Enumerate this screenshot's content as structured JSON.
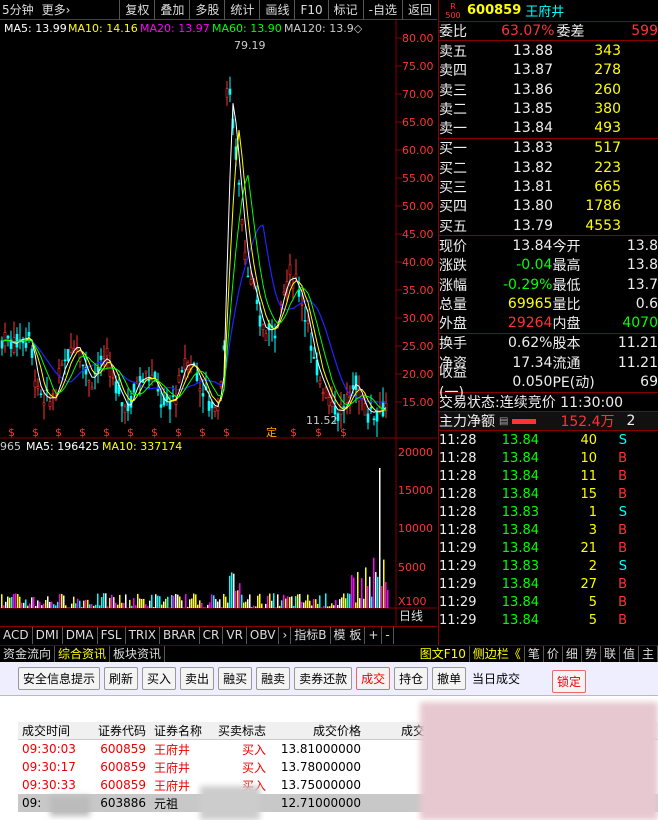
{
  "topbar": {
    "interval": "5分钟",
    "more": "更多›",
    "buttons": [
      "复权",
      "叠加",
      "多股",
      "统计",
      "画线",
      "F10",
      "标记",
      "-自选",
      "返回"
    ]
  },
  "ma_legend": {
    "ma5": "MA5: 13.99",
    "ma10": "MA10: 14.16",
    "ma20": "MA20: 13.97",
    "ma60": "MA60: 13.90",
    "ma120": "MA120: 13.9◇"
  },
  "price_axis": [
    "80.00",
    "75.00",
    "70.00",
    "65.00",
    "60.00",
    "55.00",
    "50.00",
    "45.00",
    "40.00",
    "35.00",
    "30.00",
    "25.00",
    "20.00",
    "15.00"
  ],
  "high_label": "79.19",
  "low_label": "11.52",
  "markers": [
    "$",
    "$",
    "$",
    "$",
    "$",
    "$",
    "$",
    "$",
    "$",
    "$",
    "定",
    "$",
    "$",
    "$"
  ],
  "vol_legend": {
    "vol": "965",
    "ma5": "MA5: 196425",
    "ma10": "MA10: 337174"
  },
  "vol_axis": [
    "20000",
    "15000",
    "10000",
    "5000",
    "X100"
  ],
  "indicators": [
    "ACD",
    "DMI",
    "DMA",
    "FSL",
    "TRIX",
    "BRAR",
    "CR",
    "VR",
    "OBV",
    "›",
    "指标B",
    "模 板",
    "+",
    "-"
  ],
  "tabs": [
    "资金流向",
    "综合资讯",
    "板块资讯"
  ],
  "tabs_right": [
    "图文F10",
    "侧边栏《",
    "笔",
    "价",
    "细",
    "势",
    "联",
    "值",
    "主"
  ],
  "day_label": "日线",
  "stock": {
    "code": "600859",
    "name": "王府井",
    "badge_top": "R",
    "badge_bottom": "500"
  },
  "weibi": {
    "label": "委比",
    "value": "63.07%",
    "label2": "委差",
    "value2": "599"
  },
  "asks": [
    {
      "label": "卖五",
      "price": "13.88",
      "vol": "343"
    },
    {
      "label": "卖四",
      "price": "13.87",
      "vol": "278"
    },
    {
      "label": "卖三",
      "price": "13.86",
      "vol": "260"
    },
    {
      "label": "卖二",
      "price": "13.85",
      "vol": "380"
    },
    {
      "label": "卖一",
      "price": "13.84",
      "vol": "493"
    }
  ],
  "bids": [
    {
      "label": "买一",
      "price": "13.83",
      "vol": "517"
    },
    {
      "label": "买二",
      "price": "13.82",
      "vol": "223"
    },
    {
      "label": "买三",
      "price": "13.81",
      "vol": "665"
    },
    {
      "label": "买四",
      "price": "13.80",
      "vol": "1786"
    },
    {
      "label": "买五",
      "price": "13.79",
      "vol": "4553"
    }
  ],
  "stats": [
    {
      "l1": "现价",
      "v1": "13.84",
      "l2": "今开",
      "v2": "13.8"
    },
    {
      "l1": "涨跌",
      "v1": "-0.04",
      "l2": "最高",
      "v2": "13.8"
    },
    {
      "l1": "涨幅",
      "v1": "-0.29%",
      "l2": "最低",
      "v2": "13.7"
    },
    {
      "l1": "总量",
      "v1": "69965",
      "l2": "量比",
      "v2": "0.6"
    },
    {
      "l1": "外盘",
      "v1": "29264",
      "l2": "内盘",
      "v2": "4070"
    }
  ],
  "stats2": [
    {
      "l1": "换手",
      "v1": "0.62%",
      "l2": "股本",
      "v2": "11.21"
    },
    {
      "l1": "净资",
      "v1": "17.34",
      "l2": "流通",
      "v2": "11.21"
    },
    {
      "l1": "收益(一)",
      "v1": "0.050",
      "l2": "PE(动)",
      "v2": "69"
    }
  ],
  "trade_status": {
    "label": "交易状态:",
    "value": "连续竞价 11:30:00"
  },
  "main_force": {
    "label": "主力净额",
    "value": "152.4万",
    "extra": "2"
  },
  "ticks": [
    {
      "t": "11:28",
      "p": "13.84",
      "v": "40",
      "s": "S"
    },
    {
      "t": "11:28",
      "p": "13.84",
      "v": "10",
      "s": "B"
    },
    {
      "t": "11:28",
      "p": "13.84",
      "v": "11",
      "s": "B"
    },
    {
      "t": "11:28",
      "p": "13.84",
      "v": "15",
      "s": "B"
    },
    {
      "t": "11:28",
      "p": "13.83",
      "v": "1",
      "s": "S"
    },
    {
      "t": "11:28",
      "p": "13.84",
      "v": "3",
      "s": "B"
    },
    {
      "t": "11:29",
      "p": "13.84",
      "v": "21",
      "s": "B"
    },
    {
      "t": "11:29",
      "p": "13.83",
      "v": "2",
      "s": "S"
    },
    {
      "t": "11:29",
      "p": "13.84",
      "v": "27",
      "s": "B"
    },
    {
      "t": "11:29",
      "p": "13.84",
      "v": "5",
      "s": "B"
    },
    {
      "t": "11:29",
      "p": "13.84",
      "v": "5",
      "s": "B"
    }
  ],
  "buttons": [
    "安全信息提示",
    "刷新",
    "买入",
    "卖出",
    "融买",
    "融卖",
    "卖券还款",
    "成交",
    "持仓",
    "撤单"
  ],
  "today_label": "当日成交",
  "lock": "锁定",
  "table": {
    "headers": [
      "成交时间",
      "证券代码",
      "证券名称",
      "买卖标志",
      "成交价格",
      "成交数"
    ],
    "rows": [
      {
        "time": "09:30:03",
        "code": "600859",
        "name": "王府井",
        "side": "买入",
        "price": "13.81000000"
      },
      {
        "time": "09:30:17",
        "code": "600859",
        "name": "王府井",
        "side": "买入",
        "price": "13.78000000"
      },
      {
        "time": "09:30:33",
        "code": "600859",
        "name": "王府井",
        "side": "买入",
        "price": "13.75000000"
      },
      {
        "time": "09:",
        "code": "603886",
        "name": "元祖",
        "side": "",
        "price": "12.71000000"
      }
    ]
  }
}
